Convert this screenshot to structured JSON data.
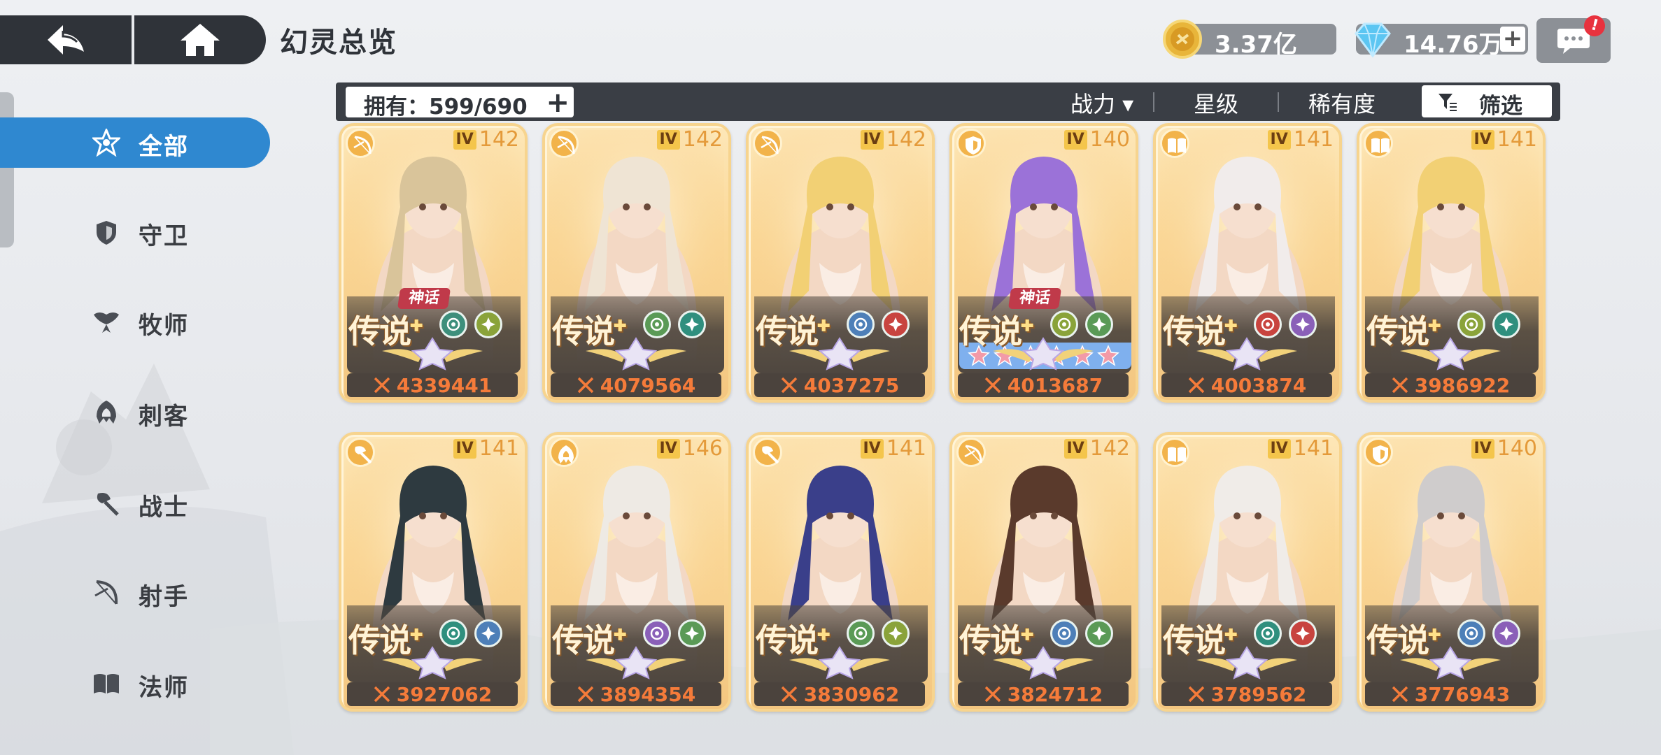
{
  "header": {
    "title": "幻灵总览",
    "gold": "3.37亿",
    "gems": "14.76万",
    "plus": "+",
    "chat_alert": "!"
  },
  "sidebar": {
    "items": [
      {
        "label": "全部",
        "icon": "all-star-icon",
        "active": true
      },
      {
        "label": "守卫",
        "icon": "shield-icon",
        "active": false
      },
      {
        "label": "牧师",
        "icon": "priest-wings-icon",
        "active": false
      },
      {
        "label": "刺客",
        "icon": "assassin-hood-icon",
        "active": false
      },
      {
        "label": "战士",
        "icon": "axe-icon",
        "active": false
      },
      {
        "label": "射手",
        "icon": "bow-icon",
        "active": false
      },
      {
        "label": "法师",
        "icon": "book-icon",
        "active": false
      }
    ]
  },
  "filter": {
    "owned": "拥有：599/690",
    "sort_power": "战力 ▾",
    "sort_star": "星级",
    "sort_rarity": "稀有度",
    "filter_label": "筛选"
  },
  "cards": [
    {
      "level_tag": "IV",
      "level": "142",
      "rarity": "传说",
      "mythic": "神话",
      "power": "4339441",
      "class": "bow-icon",
      "skills": [
        "#3d8f7c",
        "#8aa33a"
      ],
      "hair": "#d9c49a",
      "stars": false
    },
    {
      "level_tag": "IV",
      "level": "142",
      "rarity": "传说",
      "mythic": "",
      "power": "4079564",
      "class": "bow-icon",
      "skills": [
        "#5a9a56",
        "#2f8f7e"
      ],
      "hair": "#efe4d4",
      "stars": false
    },
    {
      "level_tag": "IV",
      "level": "142",
      "rarity": "传说",
      "mythic": "",
      "power": "4037275",
      "class": "bow-icon",
      "skills": [
        "#4d7fb8",
        "#c8443f"
      ],
      "hair": "#f2d074",
      "stars": false
    },
    {
      "level_tag": "IV",
      "level": "140",
      "rarity": "传说",
      "mythic": "神话",
      "power": "4013687",
      "class": "shield-icon",
      "skills": [
        "#8aa33a",
        "#5a9a56"
      ],
      "hair": "#9b72d8",
      "stars": true
    },
    {
      "level_tag": "IV",
      "level": "141",
      "rarity": "传说",
      "mythic": "",
      "power": "4003874",
      "class": "book-icon",
      "skills": [
        "#c8443f",
        "#8a60b8"
      ],
      "hair": "#f1eceb",
      "stars": false
    },
    {
      "level_tag": "IV",
      "level": "141",
      "rarity": "传说",
      "mythic": "",
      "power": "3986922",
      "class": "book-icon",
      "skills": [
        "#8aa33a",
        "#2f8f7e"
      ],
      "hair": "#f2d074",
      "stars": false
    },
    {
      "level_tag": "IV",
      "level": "141",
      "rarity": "传说",
      "mythic": "",
      "power": "3927062",
      "class": "axe-icon",
      "skills": [
        "#2f8f7e",
        "#4d7fb8"
      ],
      "hair": "#2e3a40",
      "stars": false
    },
    {
      "level_tag": "IV",
      "level": "146",
      "rarity": "传说",
      "mythic": "",
      "power": "3894354",
      "class": "assassin-hood-icon",
      "skills": [
        "#8a60b8",
        "#5a9a56"
      ],
      "hair": "#eeeae4",
      "stars": false
    },
    {
      "level_tag": "IV",
      "level": "141",
      "rarity": "传说",
      "mythic": "",
      "power": "3830962",
      "class": "axe-icon",
      "skills": [
        "#5a9a56",
        "#8aa33a"
      ],
      "hair": "#3a3f8a",
      "stars": false
    },
    {
      "level_tag": "IV",
      "level": "142",
      "rarity": "传说",
      "mythic": "",
      "power": "3824712",
      "class": "bow-icon",
      "skills": [
        "#4d7fb8",
        "#5a9a56"
      ],
      "hair": "#5a3a2c",
      "stars": false
    },
    {
      "level_tag": "IV",
      "level": "141",
      "rarity": "传说",
      "mythic": "",
      "power": "3789562",
      "class": "book-icon",
      "skills": [
        "#2f8f7e",
        "#c8443f"
      ],
      "hair": "#f0ece8",
      "stars": false
    },
    {
      "level_tag": "IV",
      "level": "140",
      "rarity": "传说",
      "mythic": "",
      "power": "3776943",
      "class": "shield-icon",
      "skills": [
        "#4d7fb8",
        "#8a60b8"
      ],
      "hair": "#cfcccc",
      "stars": false
    }
  ],
  "colors": {
    "accent": "#2f88d0",
    "dark": "#2f3339",
    "power_text": "#f57b3a",
    "card_gold": "#f7d48e"
  }
}
